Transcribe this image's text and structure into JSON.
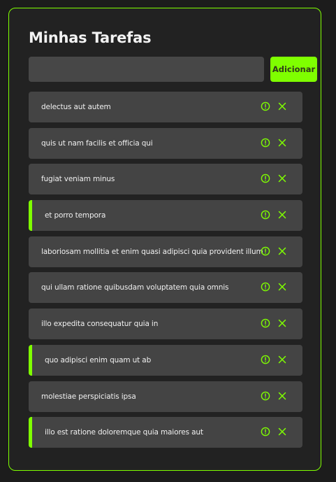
{
  "title": "Minhas Tarefas",
  "new_task": {
    "value": "",
    "placeholder": ""
  },
  "add_button_label": "Adicionar",
  "accent_color": "#7fff00",
  "icons": {
    "status": "exclamation-circle-icon",
    "delete": "close-icon"
  },
  "tasks": [
    {
      "text": "delectus aut autem",
      "completed": false
    },
    {
      "text": "quis ut nam facilis et officia qui",
      "completed": false
    },
    {
      "text": "fugiat veniam minus",
      "completed": false
    },
    {
      "text": "et porro tempora",
      "completed": true
    },
    {
      "text": "laboriosam mollitia et enim quasi adipisci quia provident illum",
      "completed": false
    },
    {
      "text": "qui ullam ratione quibusdam voluptatem quia omnis",
      "completed": false
    },
    {
      "text": "illo expedita consequatur quia in",
      "completed": false
    },
    {
      "text": "quo adipisci enim quam ut ab",
      "completed": true
    },
    {
      "text": "molestiae perspiciatis ipsa",
      "completed": false
    },
    {
      "text": "illo est ratione doloremque quia maiores aut",
      "completed": true
    }
  ]
}
